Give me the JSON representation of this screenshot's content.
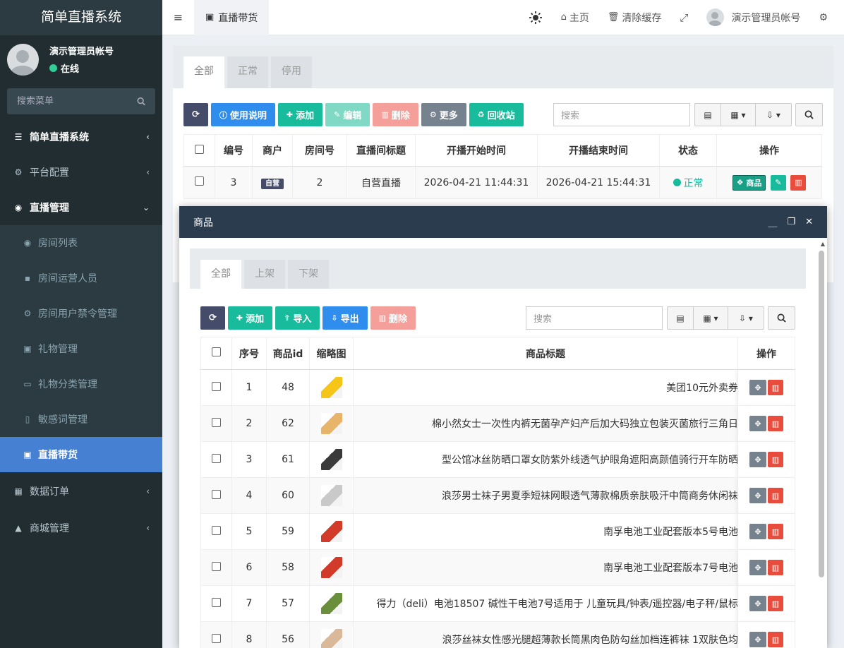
{
  "app": {
    "brand": "简单直播系统",
    "user_name": "演示管理员帐号",
    "user_status": "在线",
    "search_placeholder": "搜索菜单"
  },
  "sidebar": {
    "items": [
      {
        "label": "简单直播系统",
        "icon": "list-icon",
        "kind": "top"
      },
      {
        "label": "平台配置",
        "icon": "gear-icon",
        "kind": "group"
      },
      {
        "label": "直播管理",
        "icon": "play-circle-icon",
        "kind": "top-open"
      },
      {
        "label": "房间列表",
        "icon": "eye-icon",
        "kind": "sub"
      },
      {
        "label": "房间运营人员",
        "icon": "user-icon",
        "kind": "sub"
      },
      {
        "label": "房间用户禁令管理",
        "icon": "gears-icon",
        "kind": "sub"
      },
      {
        "label": "礼物管理",
        "icon": "gift-icon",
        "kind": "sub"
      },
      {
        "label": "礼物分类管理",
        "icon": "inbox-icon",
        "kind": "sub"
      },
      {
        "label": "敏感词管理",
        "icon": "file-word-icon",
        "kind": "sub"
      },
      {
        "label": "直播带货",
        "icon": "camera-icon",
        "kind": "sub-active"
      },
      {
        "label": "数据订单",
        "icon": "grid-icon",
        "kind": "group"
      },
      {
        "label": "商城管理",
        "icon": "shopping-bag-icon",
        "kind": "group"
      }
    ]
  },
  "header": {
    "tab_label": "直播带货",
    "home": "主页",
    "clear_cache": "清除缓存",
    "account": "演示管理员帐号"
  },
  "main": {
    "tabs": [
      "全部",
      "正常",
      "停用"
    ],
    "buttons": {
      "help": "使用说明",
      "add": "添加",
      "edit": "编辑",
      "delete": "删除",
      "more": "更多",
      "recycle": "回收站"
    },
    "search_placeholder": "搜索",
    "columns": [
      "编号",
      "商户",
      "房间号",
      "直播间标题",
      "开播开始时间",
      "开播结束时间",
      "状态",
      "操作"
    ],
    "rows": [
      {
        "id": "3",
        "merchant": "自营",
        "room": "2",
        "title": "自营直播",
        "start": "2026-04-21 11:44:31",
        "end": "2026-04-21 15:44:31",
        "status": "正常",
        "goods_btn": "商品"
      }
    ]
  },
  "modal": {
    "title": "商品",
    "tabs": [
      "全部",
      "上架",
      "下架"
    ],
    "buttons": {
      "add": "添加",
      "import": "导入",
      "export": "导出",
      "delete": "删除"
    },
    "search_placeholder": "搜索",
    "columns": [
      "序号",
      "商品id",
      "缩略图",
      "商品标题",
      "操作"
    ],
    "rows": [
      {
        "no": "1",
        "id": "48",
        "title": "美团10元外卖券",
        "thumb_color": "#f5c518"
      },
      {
        "no": "2",
        "id": "62",
        "title": "棉小然女士一次性内裤无菌孕产妇产后加大码独立包装灭菌旅行三角日",
        "thumb_color": "#e8b46a"
      },
      {
        "no": "3",
        "id": "61",
        "title": "型公馆冰丝防晒口罩女防紫外线透气护眼角遮阳高颜值骑行开车防晒",
        "thumb_color": "#3a3a3a"
      },
      {
        "no": "4",
        "id": "60",
        "title": "浪莎男士袜子男夏季短袜网眼透气薄款棉质亲肤吸汗中筒商务休闲袜",
        "thumb_color": "#c9c9c9"
      },
      {
        "no": "5",
        "id": "59",
        "title": "南孚电池工业配套版本5号电池",
        "thumb_color": "#d23a2a"
      },
      {
        "no": "6",
        "id": "58",
        "title": "南孚电池工业配套版本7号电池",
        "thumb_color": "#d23a2a"
      },
      {
        "no": "7",
        "id": "57",
        "title": "得力（deli）电池18507 碱性干电池7号适用于 儿童玩具/钟表/遥控器/电子秤/鼠标",
        "thumb_color": "#6b8e3c"
      },
      {
        "no": "8",
        "id": "56",
        "title": "浪莎丝袜女性感光腿超薄款长筒黑肉色防勾丝加档连裤袜 1双肤色均",
        "thumb_color": "#d9b99a"
      }
    ]
  }
}
